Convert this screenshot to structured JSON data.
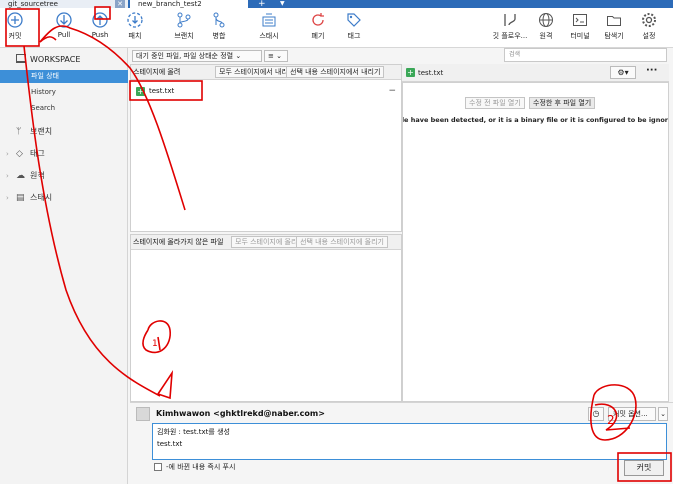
{
  "tabs": [
    {
      "label": "git_sourcetree"
    },
    {
      "label": "new_branch_test2"
    }
  ],
  "toolbar": {
    "commit": "커밋",
    "pull": "Pull",
    "push": "Push",
    "fetch": "패치",
    "branch": "브랜치",
    "merge": "병합",
    "stash": "스태시",
    "discard": "폐기",
    "tag": "태그",
    "git_flow": "깃 플로우...",
    "remote": "원격",
    "terminal": "터미널",
    "explorer": "탐색기",
    "settings": "설정"
  },
  "sidebar": {
    "workspace": "WORKSPACE",
    "items": [
      {
        "label": "파일 상태"
      },
      {
        "label": "History"
      },
      {
        "label": "Search"
      }
    ],
    "sections": [
      {
        "label": "브랜치"
      },
      {
        "label": "태그"
      },
      {
        "label": "원격"
      },
      {
        "label": "스태시"
      }
    ]
  },
  "filter": {
    "dropdown": "대기 중인 파일, 파일 상태순 정렬",
    "view_icon": "≡"
  },
  "staged": {
    "title": "스테이지에 올려",
    "unstage_all": "모두 스테이지에서 내리기",
    "unstage_selected": "선택 내용 스테이지에서 내리기",
    "files": [
      {
        "name": "test.txt"
      }
    ]
  },
  "unstaged": {
    "title": "스테이지에 올라가지 않은 파일",
    "stage_all": "모두 스테이지에 올리기",
    "stage_selected": "선택 내용 스테이지에 올리기"
  },
  "diff": {
    "file": "test.txt",
    "search_placeholder": "검색",
    "btn_before": "수정 전 파일 열기",
    "btn_after": "수정한 후 파일 열기",
    "message": "file have been detected, or it is a binary file or it is configured to be ignored l"
  },
  "commit": {
    "author": "Kimhwawon <ghktlrekd@naber.com>",
    "message_line1": "김화원 : test.txt를 생성",
    "message_line2": "test.txt",
    "push_immediately": "-에 바뀐 내용 즉시 푸시",
    "options": "커밋 옵션...",
    "button": "커밋"
  },
  "annotations": {
    "mark1": "1",
    "mark2": "2"
  },
  "colors": {
    "accent": "#3d8fd8",
    "annotation": "#e00000",
    "file_added": "#3aa757"
  }
}
